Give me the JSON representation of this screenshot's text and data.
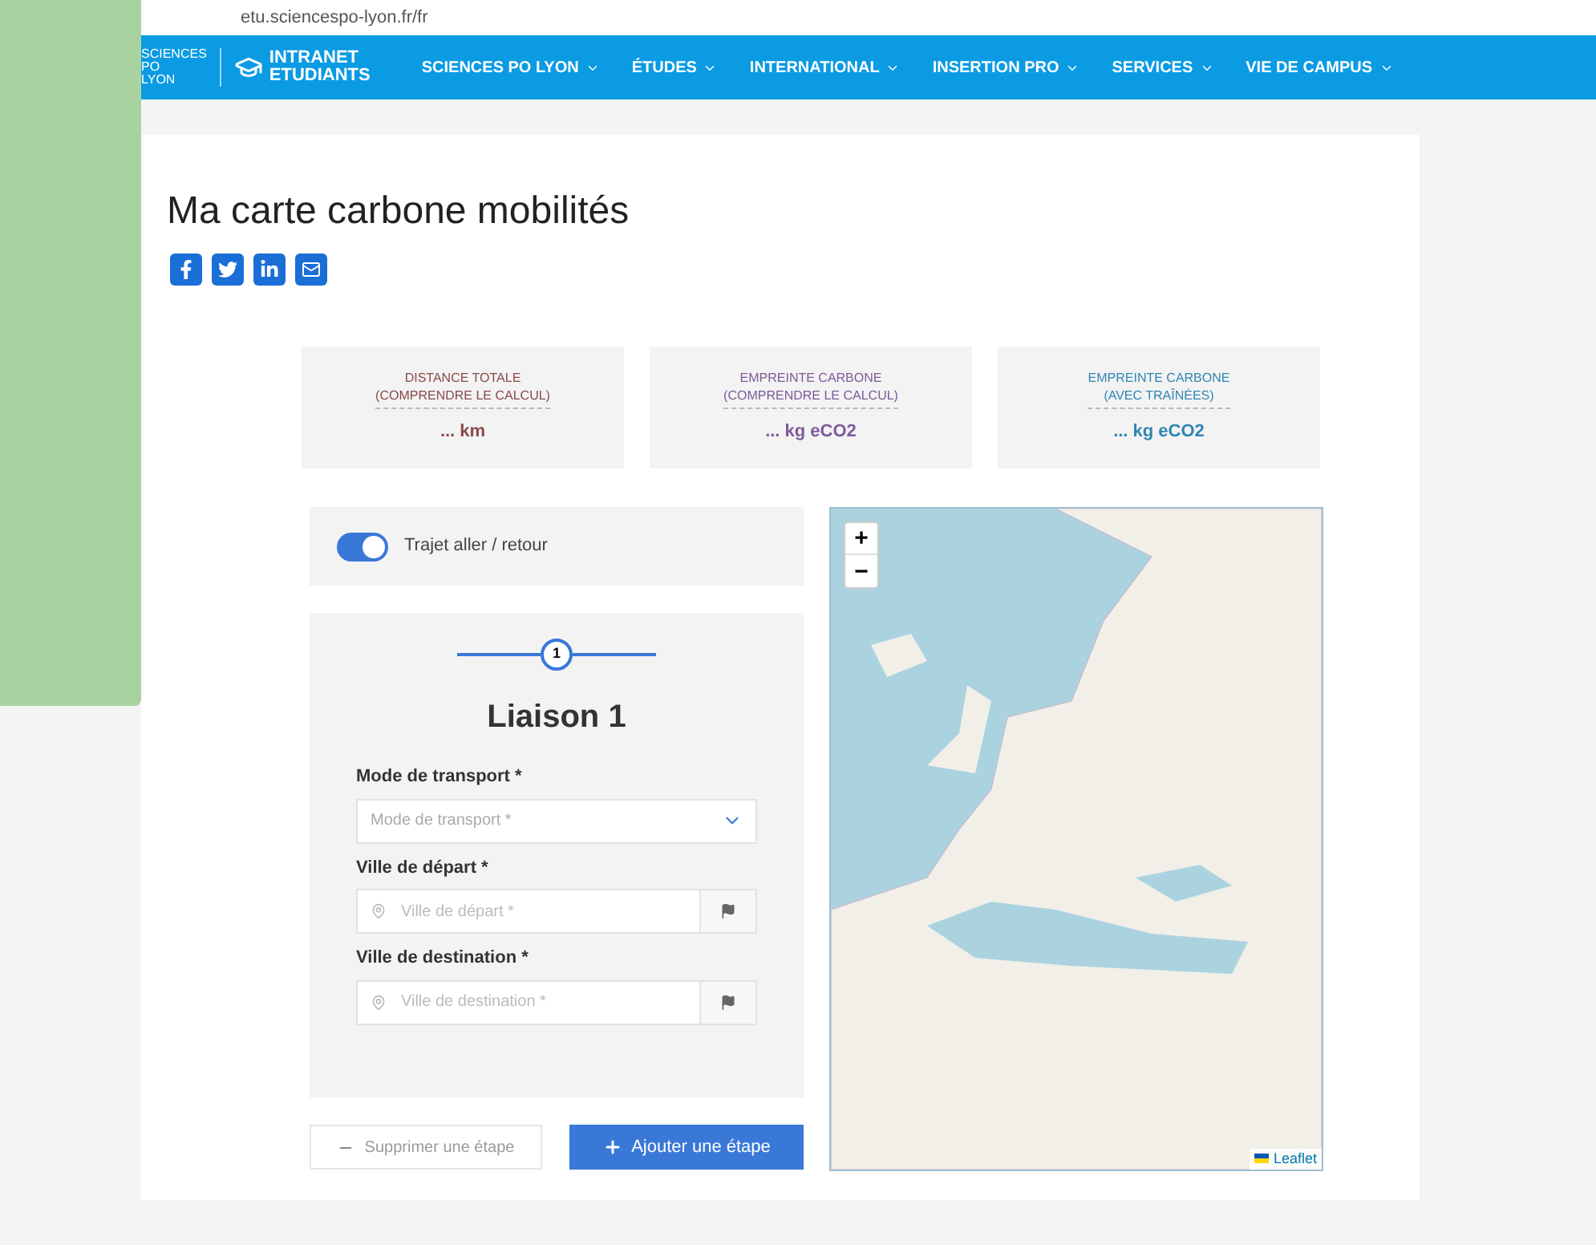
{
  "browser": {
    "url": "etu.sciencespo-lyon.fr/fr"
  },
  "nav": {
    "logo_lines": [
      "SCIENCES",
      "PO",
      "LYON"
    ],
    "intranet": [
      "INTRANET",
      "ETUDIANTS"
    ],
    "items": [
      {
        "label": "SCIENCES PO LYON"
      },
      {
        "label": "ÉTUDES"
      },
      {
        "label": "INTERNATIONAL"
      },
      {
        "label": "INSERTION PRO"
      },
      {
        "label": "SERVICES"
      },
      {
        "label": "VIE DE CAMPUS"
      }
    ]
  },
  "page": {
    "title": "Ma carte carbone mobilités",
    "share": [
      {
        "kind": "facebook"
      },
      {
        "kind": "twitter"
      },
      {
        "kind": "linkedin"
      },
      {
        "kind": "email"
      }
    ]
  },
  "stats": [
    {
      "label": [
        "DISTANCE TOTALE",
        "(COMPRENDRE LE CALCUL)"
      ],
      "value": "... km",
      "color": "#8b4a4a"
    },
    {
      "label": [
        "EMPREINTE CARBONE",
        "(COMPRENDRE LE CALCUL)"
      ],
      "value": "... kg eCO2",
      "color": "#7d5a9a"
    },
    {
      "label": [
        "EMPREINTE CARBONE",
        "(AVEC TRAÎNÉES)"
      ],
      "value": "... kg eCO2",
      "color": "#2f86b3"
    }
  ],
  "round_trip": {
    "label": "Trajet aller / retour",
    "on": true
  },
  "leg": {
    "step": "1",
    "title": "Liaison 1",
    "fields": [
      {
        "kind": "select",
        "label": "Mode de transport *",
        "placeholder": "Mode de transport *"
      },
      {
        "kind": "city",
        "label": "Ville de départ *",
        "placeholder": "Ville de départ *"
      },
      {
        "kind": "city",
        "label": "Ville de destination *",
        "placeholder": "Ville de destination *"
      }
    ]
  },
  "buttons": {
    "remove": "Supprimer une étape",
    "add": "Ajouter une étape"
  },
  "map": {
    "zoom_in": "+",
    "zoom_out": "−",
    "attribution": "Leaflet"
  }
}
